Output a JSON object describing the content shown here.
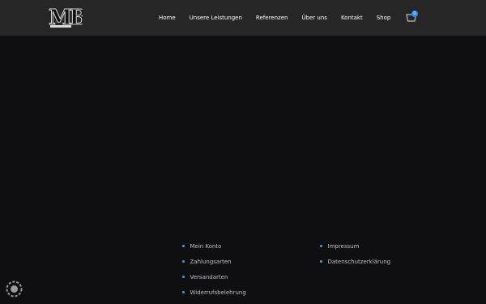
{
  "logo": {
    "text": "MB",
    "icon": "mb-logo"
  },
  "nav": {
    "items": [
      {
        "label": "Home"
      },
      {
        "label": "Unsere Leistungen"
      },
      {
        "label": "Referenzen"
      },
      {
        "label": "Über uns"
      },
      {
        "label": "Kontakt"
      },
      {
        "label": "Shop"
      }
    ]
  },
  "cart": {
    "count": "0",
    "icon": "cart-icon"
  },
  "footer": {
    "col1": [
      {
        "label": "Mein Konto"
      },
      {
        "label": "Zahlungsarten"
      },
      {
        "label": "Versandarten"
      },
      {
        "label": "Widerrufsbelehrung"
      }
    ],
    "col2": [
      {
        "label": "Impressum"
      },
      {
        "label": "Datenschutzerklärung"
      }
    ]
  },
  "colors": {
    "header_bg": "#262626",
    "page_bg": "#0f0f12",
    "accent": "#2d8cf0"
  },
  "corner_badge": {
    "icon": "cookie-settings-icon"
  }
}
